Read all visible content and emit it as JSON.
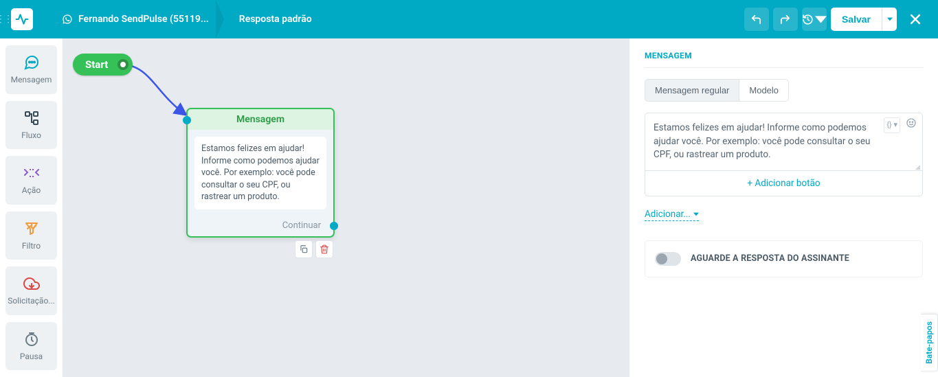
{
  "header": {
    "bot_name": "Fernando SendPulse (55119...",
    "flow_name": "Resposta padrão",
    "save_label": "Salvar"
  },
  "tools": {
    "message": "Mensagem",
    "flow": "Fluxo",
    "action": "Ação",
    "filter": "Filtro",
    "api": "Solicitação...",
    "pause": "Pausa"
  },
  "canvas": {
    "start_label": "Start",
    "msg_node_title": "Mensagem",
    "msg_node_text": "Estamos felizes em ajudar! Informe como podemos ajudar você. Por exemplo: você pode consultar o seu CPF, ou rastrear um produto.",
    "continue_label": "Continuar"
  },
  "panel": {
    "title": "MENSAGEM",
    "tab_regular": "Mensagem regular",
    "tab_template": "Modelo",
    "message_text": "Estamos felizes em ajudar! Informe como podemos ajudar você. Por exemplo: você pode consultar o seu CPF, ou rastrear um produto.",
    "variable_token": "{} ▾",
    "add_button_label": "+ Adicionar botão",
    "add_link_label": "Adicionar...",
    "await_label": "AGUARDE A RESPOSTA DO ASSINANTE"
  },
  "chat_tab_label": "Bate-papos"
}
